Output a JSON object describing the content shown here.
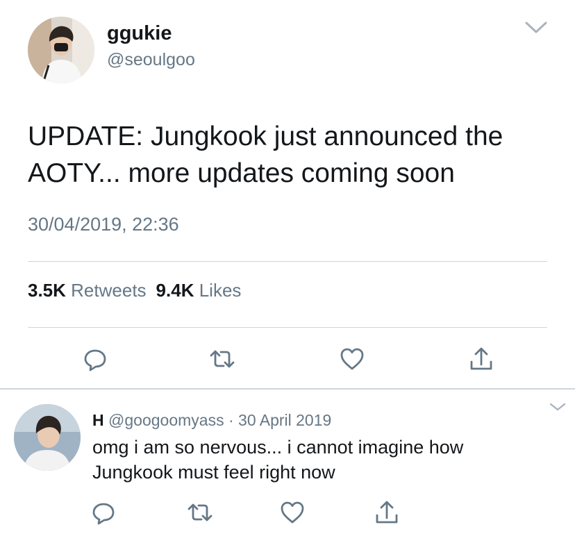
{
  "tweet": {
    "display_name": "ggukie",
    "handle": "@seoulgoo",
    "text_line1": "UPDATE: Jungkook just announced the",
    "text_line2": "AOTY... more updates coming soon",
    "timestamp": "30/04/2019, 22:36",
    "retweets_count": "3.5K",
    "retweets_label": "Retweets",
    "likes_count": "9.4K",
    "likes_label": "Likes"
  },
  "reply": {
    "name": "H",
    "handle": "@googoomyass",
    "separator": "·",
    "date": "30 April 2019",
    "text_line1": "omg i am so nervous... i cannot imagine how",
    "text_line2": "Jungkook must feel right now"
  },
  "icons": {
    "reply": "reply-bubble-icon",
    "retweet": "retweet-icon",
    "like": "heart-icon",
    "share": "share-icon",
    "caret": "chevron-down-icon"
  },
  "colors": {
    "text_primary": "#14171a",
    "text_secondary": "#657786",
    "divider": "#ccd6dd",
    "icon": "#657786"
  }
}
